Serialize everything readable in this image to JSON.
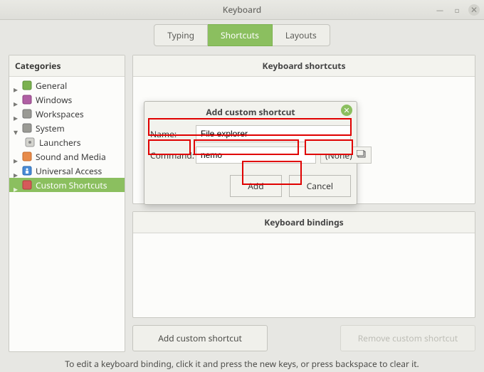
{
  "window": {
    "title": "Keyboard"
  },
  "tabs": {
    "typing": "Typing",
    "shortcuts": "Shortcuts",
    "layouts": "Layouts"
  },
  "sidebar": {
    "header": "Categories",
    "items": [
      {
        "label": "General",
        "expandable": true
      },
      {
        "label": "Windows",
        "expandable": true
      },
      {
        "label": "Workspaces",
        "expandable": true
      },
      {
        "label": "System",
        "expandable": true
      },
      {
        "label": "Launchers",
        "child": true
      },
      {
        "label": "Sound and Media",
        "expandable": true
      },
      {
        "label": "Universal Access",
        "expandable": true
      },
      {
        "label": "Custom Shortcuts",
        "expandable": true,
        "selected": true
      }
    ]
  },
  "main": {
    "shortcuts_header": "Keyboard shortcuts",
    "bindings_header": "Keyboard bindings",
    "add_button": "Add custom shortcut",
    "remove_button": "Remove custom shortcut"
  },
  "hint": "To edit a keyboard binding, click it and press the new keys, or press backspace to clear it.",
  "dialog": {
    "title": "Add custom shortcut",
    "name_label": "Name:",
    "name_value": "File explorer",
    "command_label": "Command:",
    "command_value": "nemo",
    "picker_label": "(None)",
    "add": "Add",
    "cancel": "Cancel"
  }
}
